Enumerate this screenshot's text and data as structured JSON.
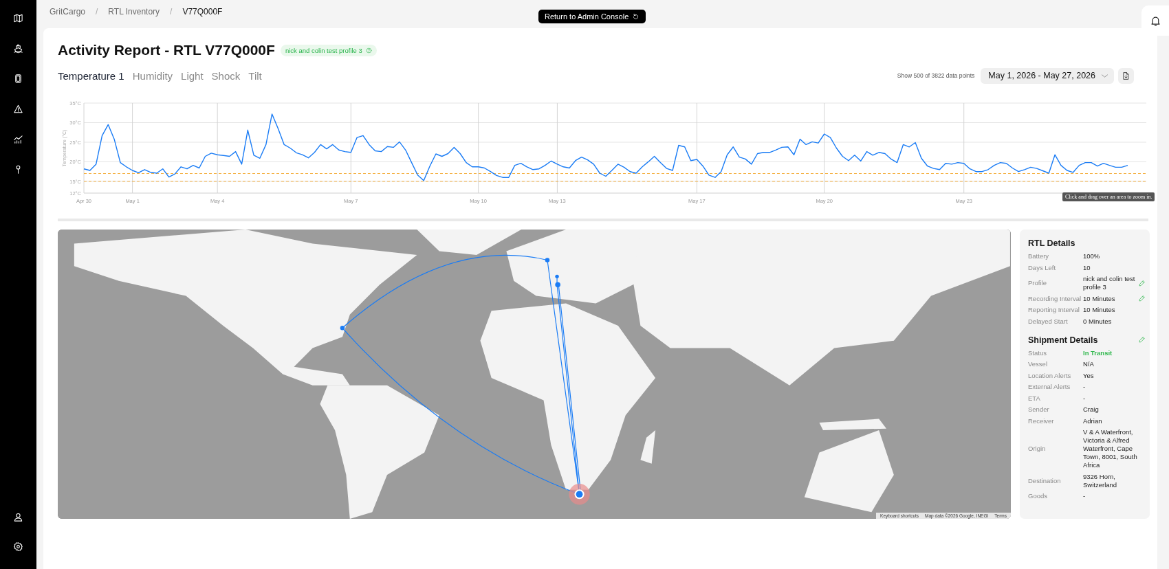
{
  "breadcrumbs": [
    {
      "label": "GritCargo",
      "current": false
    },
    {
      "label": "RTL Inventory",
      "current": false
    },
    {
      "label": "V77Q000F",
      "current": true
    }
  ],
  "breadcrumb_separators": [
    "/",
    "/"
  ],
  "admin_button": {
    "label": "Return to Admin Console"
  },
  "title": "Activity Report - RTL V77Q000F",
  "profile_badge": "nick and colin test profile 3",
  "tabs": [
    {
      "label": "Temperature 1",
      "selected": true
    },
    {
      "label": "Humidity",
      "selected": false
    },
    {
      "label": "Light",
      "selected": false
    },
    {
      "label": "Shock",
      "selected": false
    },
    {
      "label": "Tilt",
      "selected": false
    }
  ],
  "data_points_note": "Show 500 of 3822 data points",
  "date_range": "May 1, 2026 - May 27, 2026",
  "chart": {
    "hint": "Click and drag over an area to zoom in.",
    "chart_data": {
      "type": "line",
      "ylabel": "Temperature (°C)",
      "ylim": [
        12,
        35
      ],
      "categories": [
        "Apr 30",
        null,
        null,
        null,
        null,
        null,
        null,
        null,
        "May 1",
        null,
        null,
        null,
        null,
        null,
        null,
        null,
        null,
        null,
        null,
        null,
        null,
        null,
        "May 4",
        null,
        null,
        null,
        null,
        null,
        null,
        null,
        null,
        null,
        null,
        null,
        null,
        null,
        null,
        null,
        null,
        null,
        null,
        null,
        null,
        null,
        "May 7",
        null,
        null,
        null,
        null,
        null,
        null,
        null,
        null,
        null,
        null,
        null,
        null,
        null,
        null,
        null,
        null,
        null,
        null,
        null,
        null,
        "May 10",
        null,
        null,
        null,
        null,
        null,
        null,
        null,
        null,
        null,
        null,
        null,
        null,
        "May 13",
        null,
        null,
        null,
        null,
        null,
        null,
        null,
        null,
        null,
        null,
        null,
        null,
        null,
        null,
        null,
        null,
        null,
        null,
        null,
        null,
        null,
        null,
        "May 17",
        null,
        null,
        null,
        null,
        null,
        null,
        null,
        null,
        null,
        null,
        null,
        null,
        null,
        null,
        null,
        null,
        null,
        null,
        null,
        null,
        "May 20",
        null,
        null,
        null,
        null,
        null,
        null,
        null,
        null,
        null,
        null,
        null,
        null,
        null,
        null,
        null,
        null,
        null,
        null,
        null,
        null,
        null,
        null,
        "May 23",
        null,
        null,
        null,
        null,
        null,
        null,
        null,
        null,
        null,
        null,
        null,
        null,
        null,
        null,
        null,
        null,
        null,
        null,
        null,
        null,
        null,
        null,
        null,
        null,
        null,
        null,
        null
      ],
      "yticks": [
        {
          "value": 12,
          "label": "12°C"
        },
        {
          "value": 15,
          "label": "15°C"
        },
        {
          "value": 20,
          "label": "20°C"
        },
        {
          "value": 25,
          "label": "25°C"
        },
        {
          "value": 30,
          "label": "30°C"
        },
        {
          "value": 35,
          "label": "35°C"
        }
      ],
      "grid": true,
      "ref_lines": [
        {
          "axis": "y",
          "value": 17,
          "color": "#f5b041"
        },
        {
          "axis": "y",
          "value": 15,
          "color": "#f5b041"
        }
      ],
      "series": [
        {
          "color": "#1a7cf5",
          "values": [
            18.2,
            17.8,
            19.4,
            26.7,
            29.5,
            25.8,
            19.8,
            18.7,
            17.8,
            17.2,
            18,
            17.3,
            17.1,
            18.2,
            16.1,
            16.9,
            18.7,
            18.2,
            19.1,
            18.4,
            21.4,
            22.2,
            21.8,
            21.6,
            21.4,
            22.6,
            19.4,
            28.1,
            21.7,
            20.9,
            24.4,
            32.2,
            28.5,
            24.4,
            23.5,
            22.3,
            21.8,
            21,
            22.4,
            24.4,
            23.3,
            24.4,
            23,
            22.6,
            22.4,
            26.2,
            26.7,
            24.4,
            22.8,
            22.6,
            23.9,
            23.7,
            25.1,
            23,
            19.8,
            16.6,
            15.2,
            18.9,
            22,
            21.4,
            22.1,
            23.7,
            22.1,
            19.8,
            18.7,
            18.7,
            18.4,
            17.5,
            16.5,
            16,
            16,
            19.1,
            19.6,
            18.7,
            18,
            18.2,
            19.1,
            20.2,
            19.4,
            18.7,
            18.4,
            20.3,
            21.2,
            20.5,
            19.4,
            17.1,
            16.3,
            17.8,
            19.4,
            18.6,
            17.5,
            17.1,
            18.7,
            20,
            21.4,
            19.8,
            18.3,
            17.8,
            24.2,
            23.8,
            20.3,
            20.6,
            18.9,
            16.6,
            16,
            17.5,
            21.8,
            23.8,
            21.2,
            20.7,
            19.4,
            22.1,
            22.4,
            22.4,
            23,
            23.7,
            23.8,
            21.8,
            25.8,
            24.4,
            25.1,
            24.8,
            27.1,
            26.2,
            23.5,
            21.4,
            20.3,
            21.7,
            20.2,
            22.6,
            21.7,
            22.4,
            22.1,
            20.7,
            19.8,
            24.4,
            23.8,
            24.9,
            20.9,
            18.9,
            18.3,
            18,
            19.6,
            19.4,
            19.8,
            19.6,
            18.2,
            17.5,
            17.5,
            18,
            19.1,
            19.8,
            19.6,
            18.4,
            17.5,
            18,
            18.6,
            18.3,
            17.7,
            17.1,
            21.8,
            19.1,
            17.8,
            17.3,
            19.1,
            19.8,
            19.8,
            18.9,
            19.6,
            19.1,
            18.6,
            18.6,
            19.1
          ]
        }
      ]
    }
  },
  "map": {
    "attribution": [
      "Keyboard shortcuts",
      "Map data ©2026 Google, INEGI",
      "Terms"
    ]
  },
  "rtl_details": {
    "title": "RTL Details",
    "rows": [
      {
        "label": "Battery",
        "value": "100%",
        "editable": false,
        "kind": "text"
      },
      {
        "label": "Days Left",
        "value": "10",
        "editable": false,
        "kind": "text"
      },
      {
        "label": "Profile",
        "value": "nick and colin test profile 3",
        "editable": true,
        "kind": "text"
      },
      {
        "label": "Recording Interval",
        "value": "10 Minutes",
        "editable": true,
        "kind": "text"
      },
      {
        "label": "Reporting Interval",
        "value": "10 Minutes",
        "editable": false,
        "kind": "text"
      },
      {
        "label": "Delayed Start",
        "value": "0 Minutes",
        "editable": false,
        "kind": "text"
      }
    ]
  },
  "shipment_details": {
    "title": "Shipment Details",
    "editable": true,
    "rows": [
      {
        "label": "Status",
        "value": "In Transit",
        "editable": false,
        "kind": "status"
      },
      {
        "label": "Vessel",
        "value": "N/A",
        "editable": false,
        "kind": "text"
      },
      {
        "label": "Location Alerts",
        "value": "Yes",
        "editable": false,
        "kind": "text"
      },
      {
        "label": "External Alerts",
        "value": "-",
        "editable": false,
        "kind": "text"
      },
      {
        "label": "ETA",
        "value": "-",
        "editable": false,
        "kind": "text"
      },
      {
        "label": "Sender",
        "value": "Craig",
        "editable": false,
        "kind": "text"
      },
      {
        "label": "Receiver",
        "value": "Adrian",
        "editable": false,
        "kind": "text"
      },
      {
        "label": "Origin",
        "value": "V & A Waterfront, Victoria & Alfred Waterfront, Cape Town, 8001, South Africa",
        "editable": false,
        "kind": "text"
      },
      {
        "label": "Destination",
        "value": "9326 Horn, Switzerland",
        "editable": false,
        "kind": "text"
      },
      {
        "label": "Goods",
        "value": "-",
        "editable": false,
        "kind": "text"
      }
    ]
  }
}
